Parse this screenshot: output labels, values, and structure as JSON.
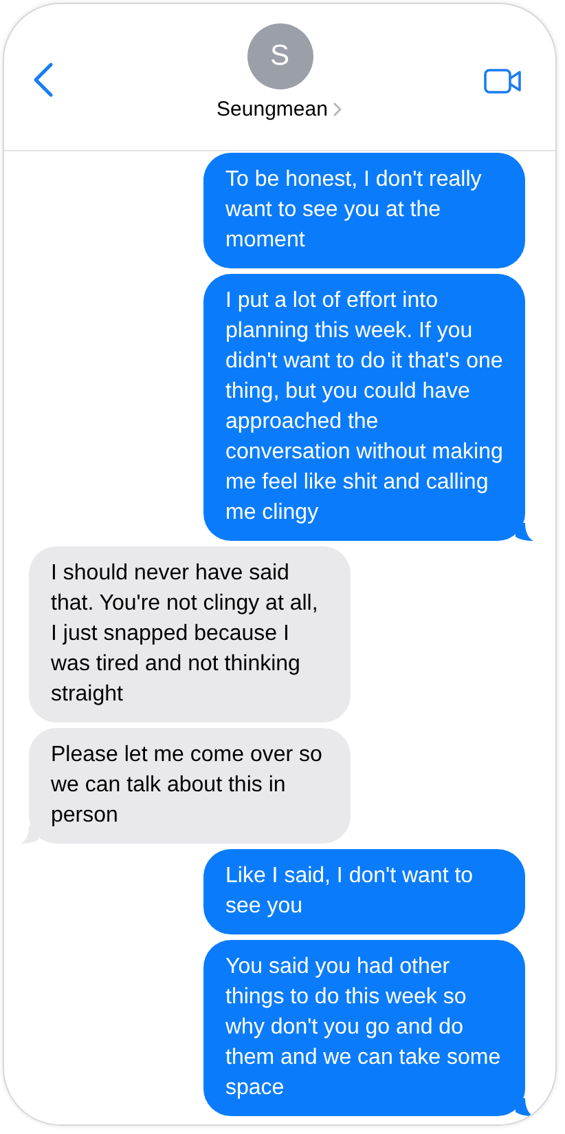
{
  "header": {
    "avatar_initial": "S",
    "contact_name": "Seungmean"
  },
  "messages": [
    {
      "kind": "sent",
      "tail": false,
      "text": "To be honest, I don't really want to see you at the moment"
    },
    {
      "kind": "sent",
      "tail": true,
      "text": "I put a lot of effort into planning this week. If you didn't want to do it that's one thing, but you could have approached the conversation without making me feel like shit and calling me clingy"
    },
    {
      "kind": "received",
      "tail": false,
      "text": "I should never have said that. You're not clingy at all, I just snapped because I was tired and not thinking straight"
    },
    {
      "kind": "received",
      "tail": true,
      "text": "Please let me come over so we can talk about this in person"
    },
    {
      "kind": "sent",
      "tail": false,
      "text": "Like I said, I don't want to see you"
    },
    {
      "kind": "sent",
      "tail": true,
      "text": "You said you had other things to do this week so why don't you go and do them and we can take some space"
    }
  ]
}
